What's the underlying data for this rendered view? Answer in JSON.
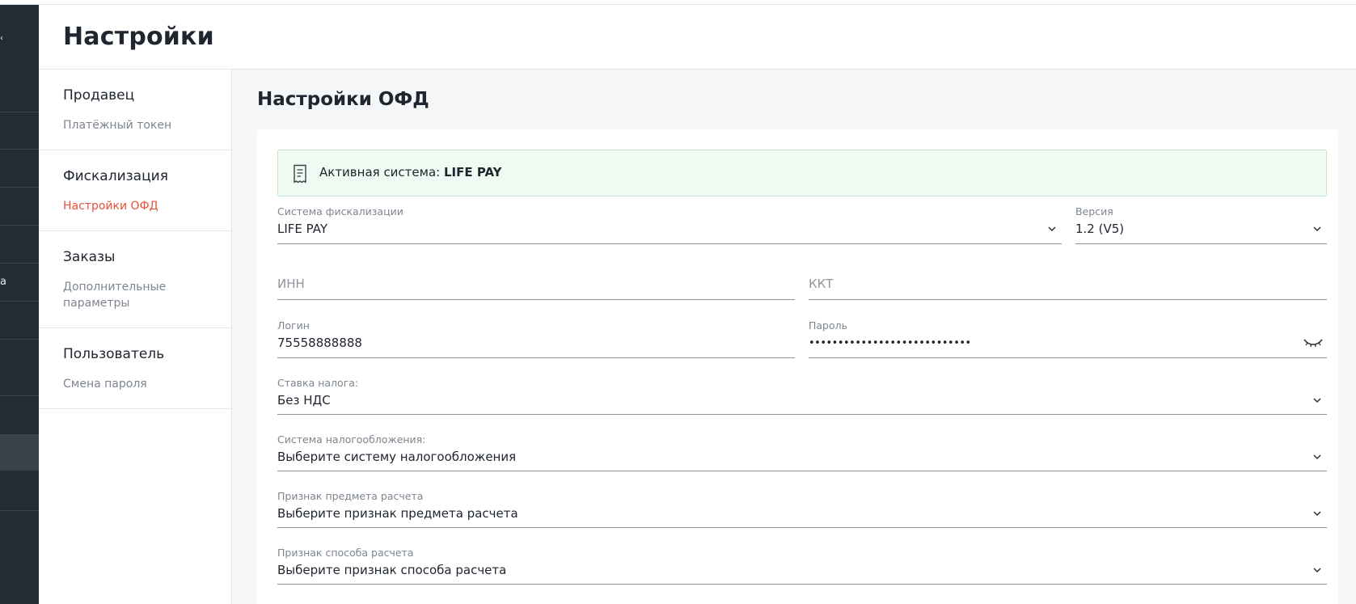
{
  "header": {
    "title": "Настройки"
  },
  "rail": {
    "fragments": [
      "a"
    ]
  },
  "nav": {
    "groups": [
      {
        "title": "Продавец",
        "items": [
          "Платёжный токен"
        ]
      },
      {
        "title": "Фискализация",
        "items": [
          "Настройки ОФД"
        ]
      },
      {
        "title": "Заказы",
        "items": [
          "Дополнительные параметры"
        ]
      },
      {
        "title": "Пользователь",
        "items": [
          "Смена пароля"
        ]
      }
    ],
    "active_item": "Настройки ОФД"
  },
  "main": {
    "title": "Настройки ОФД",
    "alert": {
      "prefix": "Активная система:",
      "system": "LIFE PAY"
    },
    "fields": {
      "fiscal_system": {
        "label": "Система фискализации",
        "value": "LIFE PAY"
      },
      "version": {
        "label": "Версия",
        "value": "1.2 (V5)"
      },
      "inn": {
        "placeholder": "ИНН"
      },
      "kkt": {
        "placeholder": "ККТ"
      },
      "login": {
        "label": "Логин",
        "value": "75558888888"
      },
      "password": {
        "label": "Пароль",
        "value": "••••••••••••••••••••••••••••"
      },
      "tax_rate": {
        "label": "Ставка налога:",
        "value": "Без НДС"
      },
      "tax_system": {
        "label": "Система налогообложения:",
        "value": "Выберите систему налогообложения"
      },
      "subject_sign": {
        "label": "Признак предмета расчета",
        "value": "Выберите признак предмета расчета"
      },
      "method_sign": {
        "label": "Признак способа расчета",
        "value": "Выберите признак способа расчета"
      }
    }
  },
  "colors": {
    "accent": "#e8503a",
    "rail": "#242c33",
    "alert_bg": "#eefaf2"
  }
}
